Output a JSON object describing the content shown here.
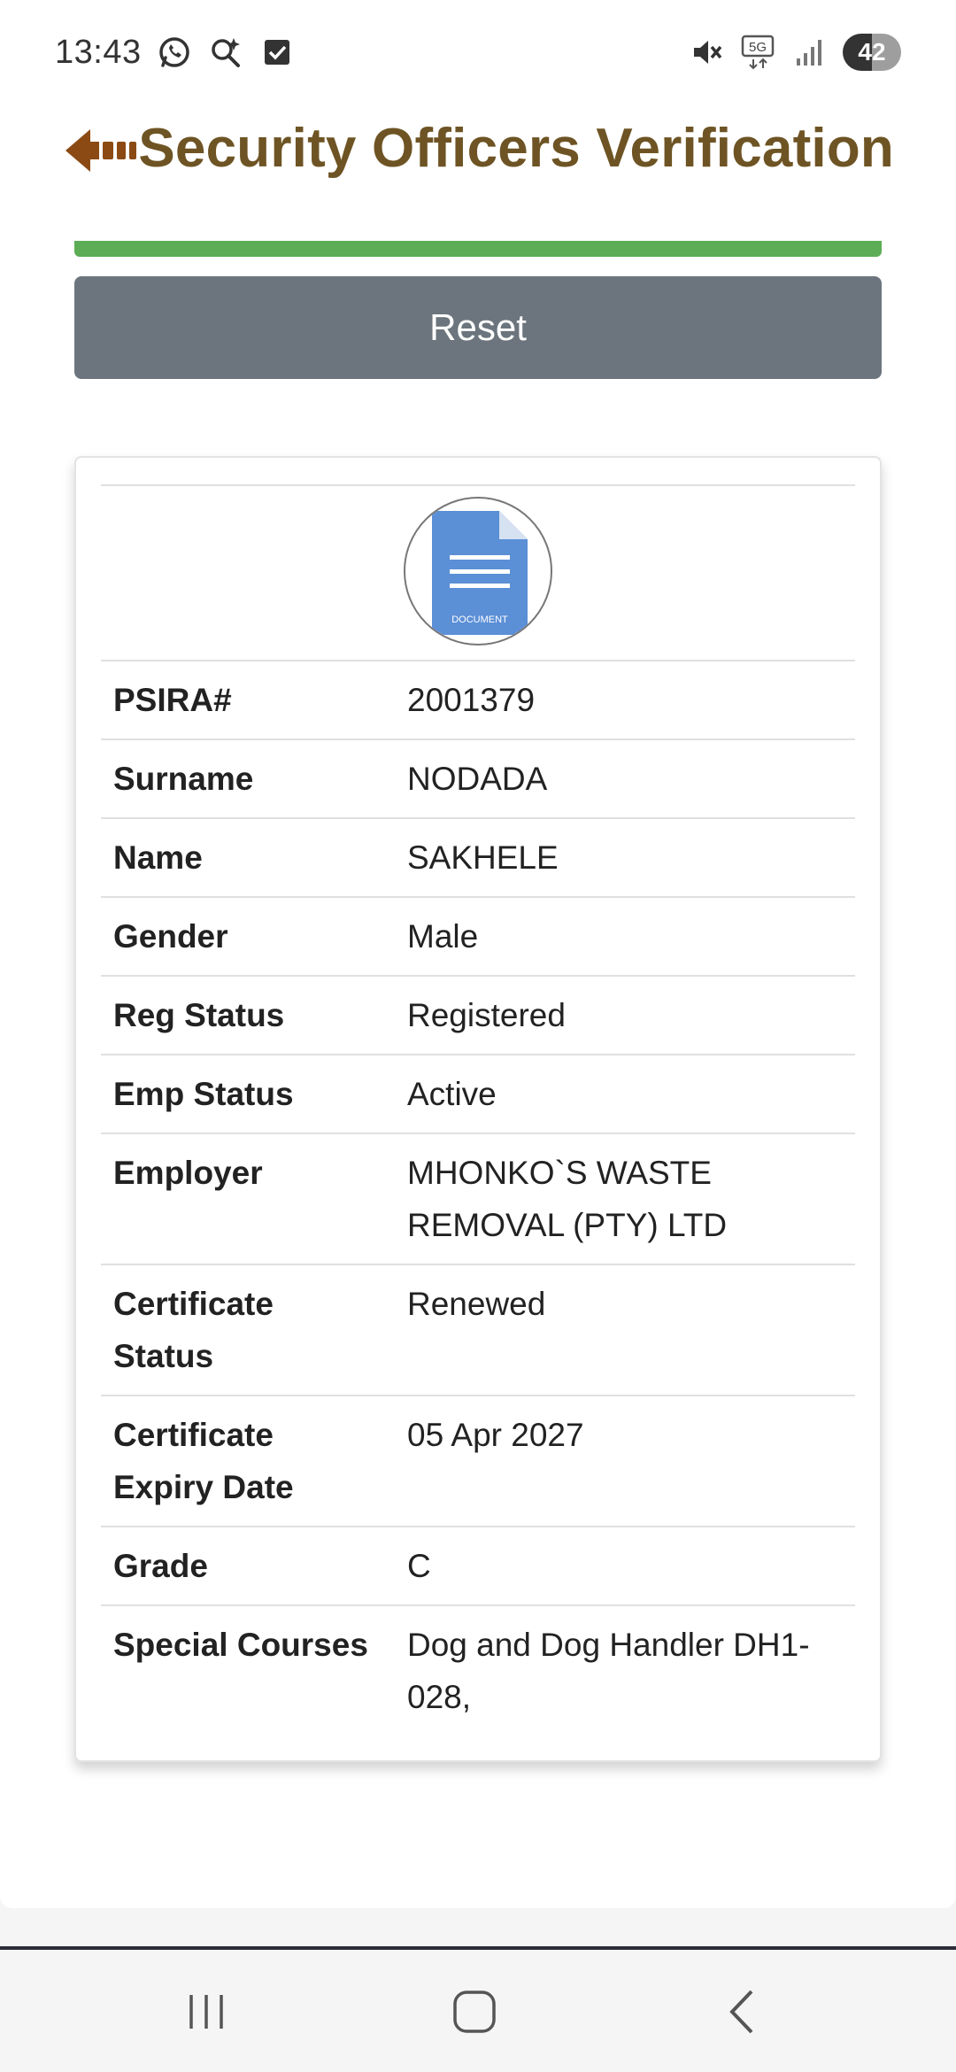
{
  "status_bar": {
    "time": "13:43",
    "left_icons": [
      "whatsapp-icon",
      "search-sparkle-icon",
      "checkbox-icon"
    ],
    "right_icons": [
      "mute-icon",
      "5g-icon",
      "signal-icon"
    ],
    "network_label": "5G",
    "battery": "42"
  },
  "header": {
    "title": "Security Officers Verification",
    "back_icon": "back-arrow-icon",
    "title_color": "#6e5424"
  },
  "actions": {
    "reset_label": "Reset",
    "reset_color": "#6c757d",
    "progress_color": "#5cad55"
  },
  "card": {
    "avatar": {
      "icon": "document-icon",
      "caption": "DOCUMENT"
    },
    "rows": [
      {
        "label": "PSIRA#",
        "value": "2001379"
      },
      {
        "label": "Surname",
        "value": "NODADA"
      },
      {
        "label": "Name",
        "value": "SAKHELE"
      },
      {
        "label": "Gender",
        "value": "Male"
      },
      {
        "label": "Reg Status",
        "value": "Registered"
      },
      {
        "label": "Emp Status",
        "value": "Active"
      },
      {
        "label": "Employer",
        "value": "MHONKO`S WASTE REMOVAL (PTY) LTD"
      },
      {
        "label": "Certificate Status",
        "value": "Renewed"
      },
      {
        "label": "Certificate Expiry Date",
        "value": "05 Apr 2027"
      },
      {
        "label": "Grade",
        "value": "C"
      },
      {
        "label": "Special Courses",
        "value": "Dog and Dog Handler DH1-028,"
      }
    ]
  },
  "nav_bar": {
    "icons": [
      "recent-apps-icon",
      "home-icon",
      "back-icon"
    ]
  }
}
